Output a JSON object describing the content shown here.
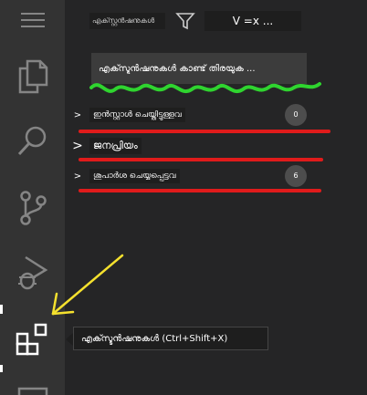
{
  "activity_bar": {
    "items": [
      {
        "icon": "menu-icon"
      },
      {
        "icon": "explorer-icon"
      },
      {
        "icon": "search-icon"
      },
      {
        "icon": "source-control-icon"
      },
      {
        "icon": "run-debug-icon"
      },
      {
        "icon": "extensions-icon"
      },
      {
        "icon": "partial-icon"
      }
    ]
  },
  "sidebar": {
    "title": "എക്സ്റ്റൻഷനുകൾ",
    "more_label": "V =x ...",
    "search": {
      "placeholder": "എക്സ്ടൻഷനുകൾ കാണ്ട് തിരയുക ..."
    },
    "sections": [
      {
        "label": "ഇൻസ്റ്റാൾ ചെയ്തിട്ടുള്ളവ",
        "count": "0"
      },
      {
        "label": "ജനപ്രിയം",
        "count": ""
      },
      {
        "label": "ശുപാർശ ചെയ്യപ്പെട്ടവ",
        "count": "6"
      }
    ]
  },
  "tooltip": {
    "text": "എക്സ്ടൻഷനുകൾ (Ctrl+Shift+X)"
  },
  "colors": {
    "accent_red": "#e01b1b",
    "squiggle_green": "#2fd42f",
    "arrow_yellow": "#f5e12e"
  }
}
